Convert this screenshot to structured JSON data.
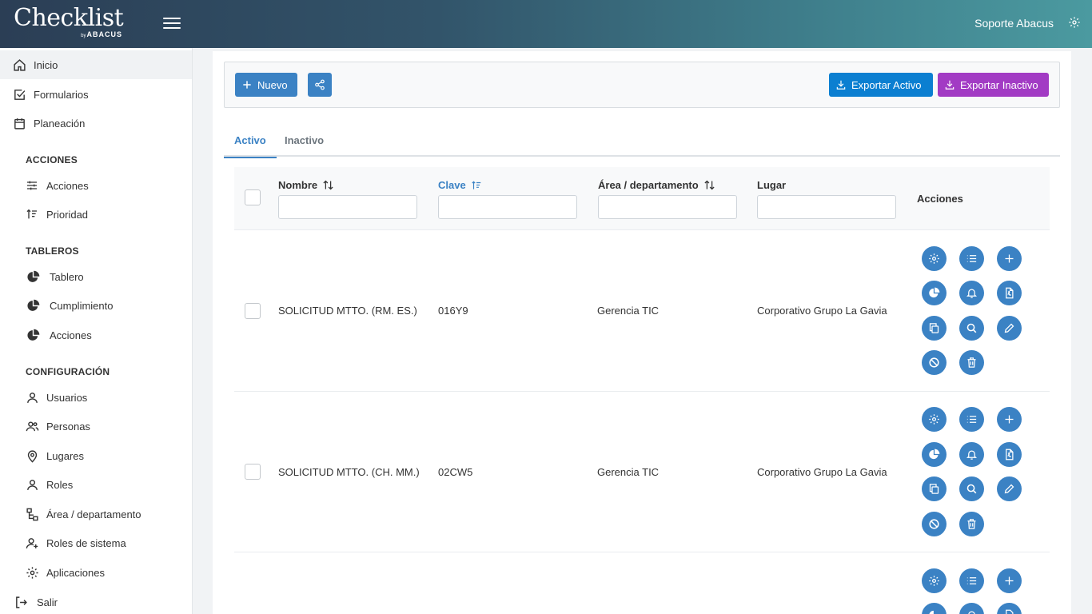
{
  "header": {
    "logo_main": "Checklist",
    "logo_by": "by",
    "logo_brand": "ABACUS",
    "user_name": "Soporte Abacus"
  },
  "sidebar": {
    "top_items": [
      {
        "label": "Inicio",
        "icon": "home-icon"
      },
      {
        "label": "Formularios",
        "icon": "checkbox-icon"
      },
      {
        "label": "Planeación",
        "icon": "calendar-icon"
      }
    ],
    "sections": [
      {
        "title": "ACCIONES",
        "items": [
          {
            "label": "Acciones",
            "icon": "sliders-icon"
          },
          {
            "label": "Prioridad",
            "icon": "sort-priority-icon"
          }
        ]
      },
      {
        "title": "TABLEROS",
        "items": [
          {
            "label": "Tablero",
            "icon": "pie-chart-icon"
          },
          {
            "label": "Cumplimiento",
            "icon": "pie-chart-icon"
          },
          {
            "label": "Acciones",
            "icon": "pie-chart-icon"
          }
        ]
      },
      {
        "title": "CONFIGURACIÓN",
        "items": [
          {
            "label": "Usuarios",
            "icon": "user-icon"
          },
          {
            "label": "Personas",
            "icon": "users-icon"
          },
          {
            "label": "Lugares",
            "icon": "map-pin-icon"
          },
          {
            "label": "Roles",
            "icon": "user-icon"
          },
          {
            "label": "Área / departamento",
            "icon": "org-chart-icon"
          },
          {
            "label": "Roles de sistema",
            "icon": "user-plus-icon"
          },
          {
            "label": "Aplicaciones",
            "icon": "gear-icon"
          }
        ]
      }
    ],
    "logout": {
      "label": "Salir",
      "icon": "logout-icon"
    }
  },
  "toolbar": {
    "new_label": "Nuevo",
    "export_active_label": "Exportar Activo",
    "export_inactive_label": "Exportar Inactivo"
  },
  "tabs": [
    {
      "label": "Activo",
      "active": true
    },
    {
      "label": "Inactivo",
      "active": false
    }
  ],
  "table": {
    "columns": {
      "nombre": "Nombre",
      "clave": "Clave",
      "area": "Área / departamento",
      "lugar": "Lugar",
      "acciones": "Acciones"
    },
    "rows": [
      {
        "nombre": "SOLICITUD MTTO. (RM. ES.)",
        "clave": "016Y9",
        "area": "Gerencia TIC",
        "lugar": "Corporativo Grupo La Gavia"
      },
      {
        "nombre": "SOLICITUD MTTO. (CH. MM.)",
        "clave": "02CW5",
        "area": "Gerencia TIC",
        "lugar": "Corporativo Grupo La Gavia"
      }
    ]
  },
  "colors": {
    "primary": "#3b82c4",
    "export_active": "#0b7fd1",
    "export_inactive": "#a23bc4"
  }
}
